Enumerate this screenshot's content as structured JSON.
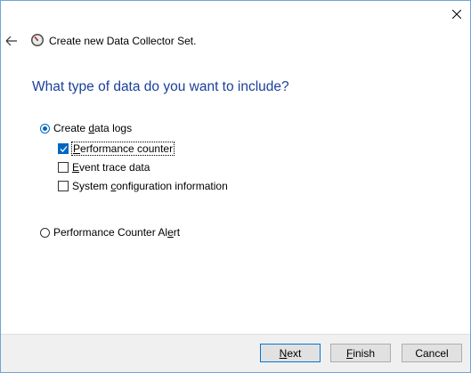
{
  "dialog": {
    "title": "Create new Data Collector Set.",
    "heading": "What type of data do you want to include?"
  },
  "options": {
    "create_logs": {
      "pre": "Create ",
      "key": "d",
      "post": "ata logs",
      "selected": true
    },
    "alert": {
      "pre": "Performance Counter Al",
      "key": "e",
      "post": "rt",
      "selected": false
    }
  },
  "checkboxes": [
    {
      "pre": "",
      "key": "P",
      "post": "erformance counter",
      "checked": true
    },
    {
      "pre": "",
      "key": "E",
      "post": "vent trace data",
      "checked": false
    },
    {
      "pre": "System ",
      "key": "c",
      "post": "onfiguration information",
      "checked": false
    }
  ],
  "buttons": {
    "next": {
      "pre": "",
      "key": "N",
      "post": "ext"
    },
    "finish": {
      "pre": "",
      "key": "F",
      "post": "inish"
    },
    "cancel": "Cancel"
  },
  "colors": {
    "accent": "#0067c0",
    "heading": "#1b3f9b",
    "footer": "#f0f0f0"
  },
  "icons": [
    "close-icon",
    "back-arrow-icon",
    "performance-monitor-icon"
  ]
}
